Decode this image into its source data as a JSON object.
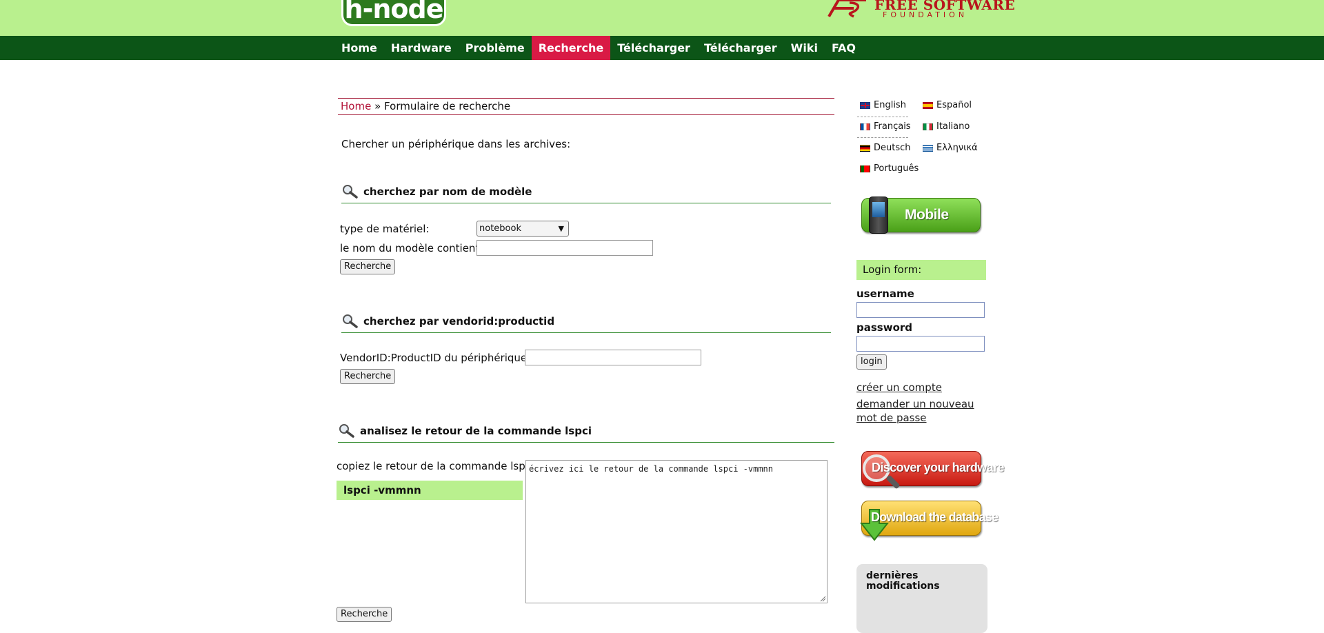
{
  "header": {
    "logo_text": "h-node",
    "fsf_title": "FREE SOFTWARE",
    "fsf_subtitle": "FOUNDATION"
  },
  "nav": {
    "items": [
      {
        "label": "Home",
        "active": false
      },
      {
        "label": "Hardware",
        "active": false
      },
      {
        "label": "Problème",
        "active": false
      },
      {
        "label": "Recherche",
        "active": true
      },
      {
        "label": "Télécharger",
        "active": false
      },
      {
        "label": "Télécharger",
        "active": false
      },
      {
        "label": "Wiki",
        "active": false
      },
      {
        "label": "FAQ",
        "active": false
      }
    ],
    "active_color": "#d91a45",
    "bar_color": "#0c5517"
  },
  "breadcrumb": {
    "home": "Home",
    "separator": "»",
    "current": "Formulaire de recherche"
  },
  "intro": "Chercher un périphérique dans les archives:",
  "model_search": {
    "title": "cherchez par nom de modèle",
    "type_label": "type de matériel:",
    "type_value": "notebook",
    "model_label": "le nom du modèle contient:",
    "model_value": "",
    "submit": "Recherche"
  },
  "vendor_search": {
    "title": "cherchez par vendorid:productid",
    "id_label": "VendorID:ProductID du périphérique:",
    "id_value": "",
    "submit": "Recherche"
  },
  "lspci_search": {
    "title": "analisez le retour de la commande lspci",
    "paste_label": "copiez le retour de la commande lspci:",
    "command_box": "lspci -vmmnn",
    "textarea_value": "écrivez ici le retour de la commande lspci -vmmnn",
    "submit": "Recherche"
  },
  "languages": [
    {
      "label": "English",
      "flag": "uk-flag"
    },
    {
      "label": "Español",
      "flag": "spain-flag"
    },
    {
      "label": "Français",
      "flag": "france-flag"
    },
    {
      "label": "Italiano",
      "flag": "italy-flag"
    },
    {
      "label": "Deutsch",
      "flag": "germany-flag"
    },
    {
      "label": "Ελληνικά",
      "flag": "greece-flag"
    },
    {
      "label": "Português",
      "flag": "portugal-flag"
    }
  ],
  "sidebar": {
    "mobile_button": "Mobile",
    "login_title": "Login form:",
    "username_label": "username",
    "username_value": "",
    "password_label": "password",
    "password_value": "",
    "login_button": "login",
    "create_account": "créer un compte",
    "new_password_line1": "demander un nouveau",
    "new_password_line2": "mot de passe",
    "discover_button": "Discover your hardware",
    "download_button": "Download the database",
    "recent_title": "dernières modifications"
  },
  "colors": {
    "banner_green": "#b9f08e",
    "section_rule_green": "#2f8a2b",
    "breadcrumb_red": "#a0112f"
  }
}
